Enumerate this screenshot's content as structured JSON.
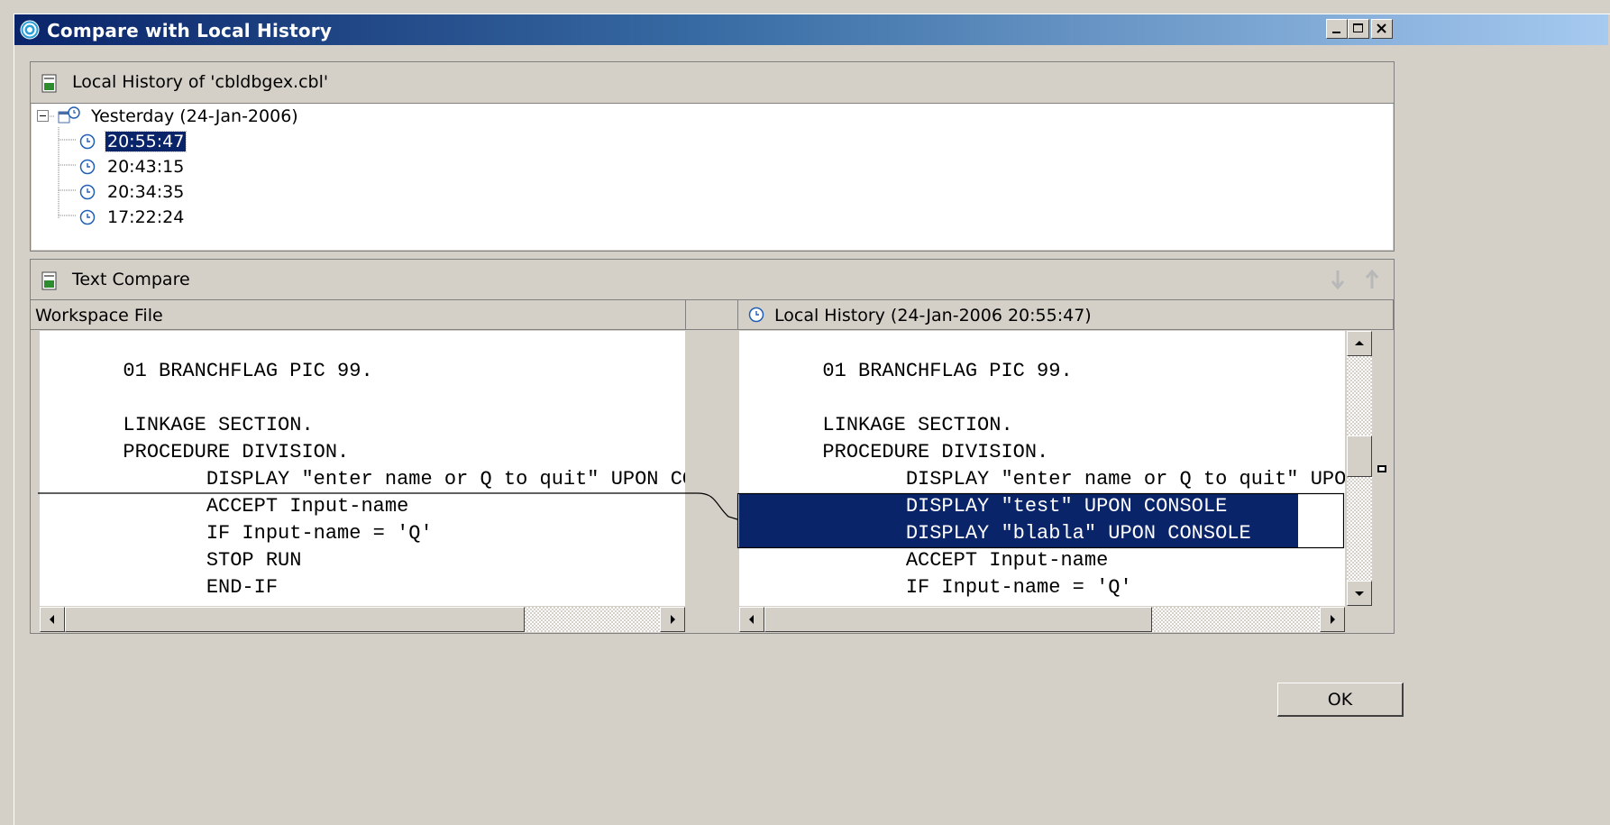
{
  "window": {
    "title": "Compare with Local History",
    "controls": {
      "minimize": "_",
      "maximize": "□",
      "close": "✕"
    }
  },
  "history_panel": {
    "title": "Local History of 'cbldbgex.cbl'",
    "tree": {
      "group_label": "Yesterday (24-Jan-2006)",
      "expander": "−",
      "items": [
        {
          "label": "20:55:47",
          "selected": true
        },
        {
          "label": "20:43:15",
          "selected": false
        },
        {
          "label": "20:34:35",
          "selected": false
        },
        {
          "label": "17:22:24",
          "selected": false
        }
      ]
    }
  },
  "compare_panel": {
    "title": "Text Compare",
    "left_pane": {
      "title": "Workspace File",
      "lines": [
        "",
        "       01 BRANCHFLAG PIC 99.",
        "",
        "       LINKAGE SECTION.",
        "       PROCEDURE DIVISION.",
        "              DISPLAY \"enter name or Q to quit\" UPON CONSOLE",
        "              ACCEPT Input-name",
        "              IF Input-name = 'Q'",
        "              STOP RUN",
        "              END-IF"
      ]
    },
    "right_pane": {
      "title": "Local History (24-Jan-2006 20:55:47)",
      "lines": [
        "",
        "       01 BRANCHFLAG PIC 99.",
        "",
        "       LINKAGE SECTION.",
        "       PROCEDURE DIVISION.",
        "              DISPLAY \"enter name or Q to quit\" UPON CONSOLE",
        "              DISPLAY \"test\" UPON CONSOLE",
        "              DISPLAY \"blabla\" UPON CONSOLE",
        "              ACCEPT Input-name",
        "              IF Input-name = 'Q'"
      ],
      "highlighted_lines": [
        6,
        7
      ]
    }
  },
  "buttons": {
    "ok": "OK"
  },
  "colors": {
    "selection": "#0a246a",
    "face": "#d4d0c8"
  }
}
